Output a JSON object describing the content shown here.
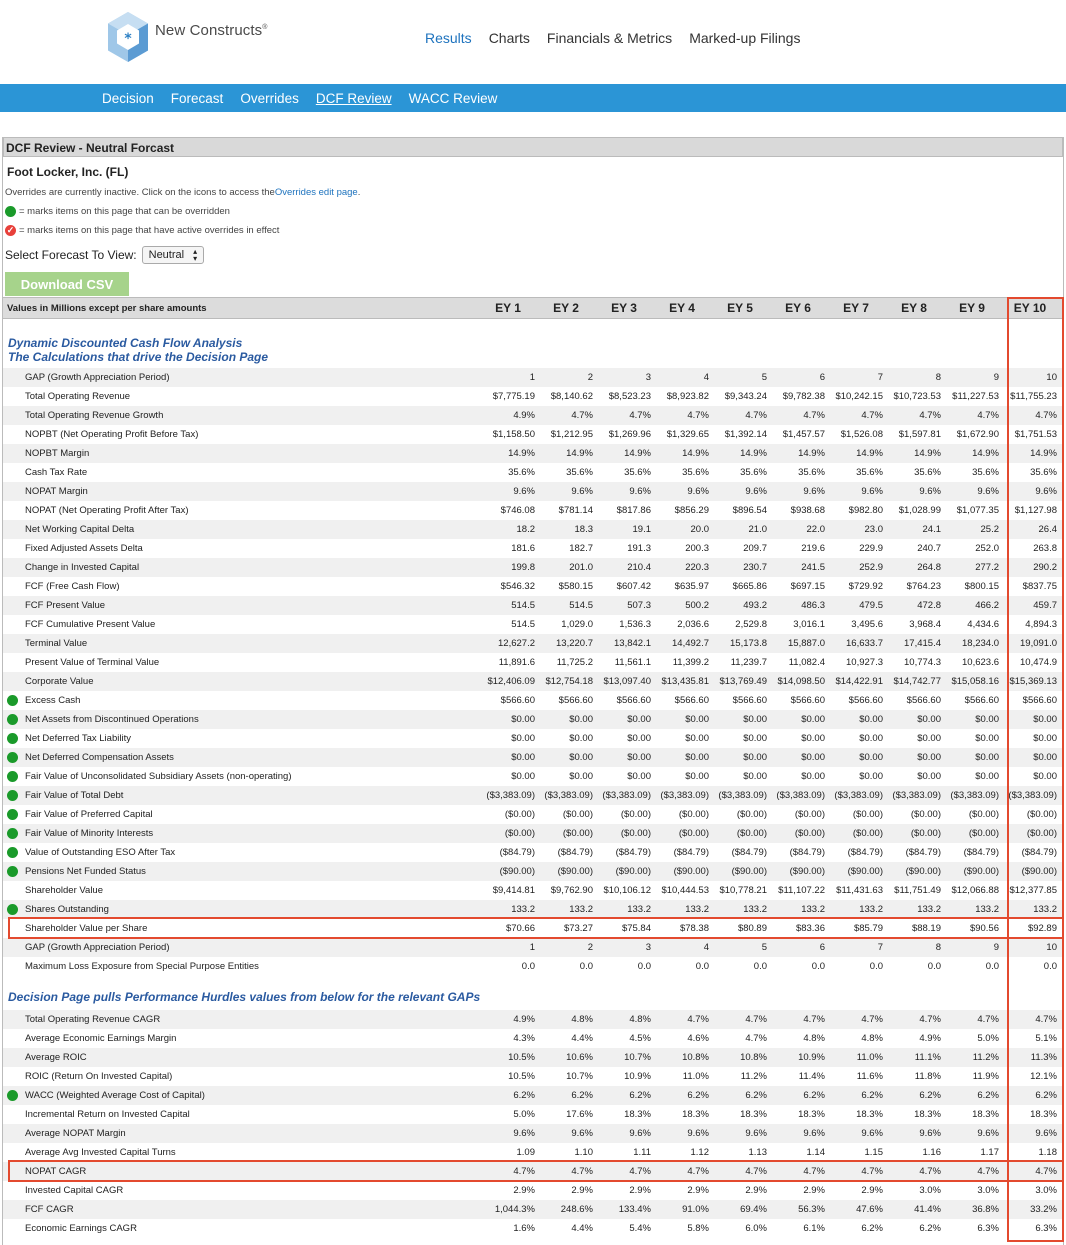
{
  "brand": {
    "name": "New Constructs",
    "mark": "®"
  },
  "top_nav": [
    {
      "label": "Results",
      "active": true
    },
    {
      "label": "Charts",
      "active": false
    },
    {
      "label": "Financials & Metrics",
      "active": false
    },
    {
      "label": "Marked-up Filings",
      "active": false
    }
  ],
  "sub_nav": [
    {
      "label": "Decision",
      "active": false
    },
    {
      "label": "Forecast",
      "active": false
    },
    {
      "label": "Overrides",
      "active": false
    },
    {
      "label": "DCF Review",
      "active": true
    },
    {
      "label": "WACC Review",
      "active": false
    }
  ],
  "panel": {
    "title": "DCF Review - Neutral Forcast",
    "company": "Foot Locker, Inc. (FL)",
    "override_note": "Overrides are currently inactive. Click on the icons to access the ",
    "override_link": "Overrides edit page",
    "override_note_end": ".",
    "legend_green": "= marks items on this page that can be overridden",
    "legend_red": "= marks items on this page that have active overrides in effect",
    "select_label": "Select Forecast To View:",
    "select_value": "Neutral",
    "csv_button": "Download CSV"
  },
  "table": {
    "header_label": "Values in Millions except per share amounts",
    "columns": [
      "EY 1",
      "EY 2",
      "EY 3",
      "EY 4",
      "EY 5",
      "EY 6",
      "EY 7",
      "EY 8",
      "EY 9",
      "EY 10"
    ],
    "section1_title": "Dynamic Discounted Cash Flow Analysis",
    "section1_subtitle": "The Calculations that drive the Decision Page",
    "section1_rows": [
      {
        "label": "GAP (Growth Appreciation Period)",
        "dot": false,
        "values": [
          "1",
          "2",
          "3",
          "4",
          "5",
          "6",
          "7",
          "8",
          "9",
          "10"
        ]
      },
      {
        "label": "Total Operating Revenue",
        "dot": false,
        "values": [
          "$7,775.19",
          "$8,140.62",
          "$8,523.23",
          "$8,923.82",
          "$9,343.24",
          "$9,782.38",
          "$10,242.15",
          "$10,723.53",
          "$11,227.53",
          "$11,755.23"
        ]
      },
      {
        "label": "Total Operating Revenue Growth",
        "dot": false,
        "values": [
          "4.9%",
          "4.7%",
          "4.7%",
          "4.7%",
          "4.7%",
          "4.7%",
          "4.7%",
          "4.7%",
          "4.7%",
          "4.7%"
        ]
      },
      {
        "label": "NOPBT (Net Operating Profit Before Tax)",
        "dot": false,
        "values": [
          "$1,158.50",
          "$1,212.95",
          "$1,269.96",
          "$1,329.65",
          "$1,392.14",
          "$1,457.57",
          "$1,526.08",
          "$1,597.81",
          "$1,672.90",
          "$1,751.53"
        ]
      },
      {
        "label": "NOPBT Margin",
        "dot": false,
        "values": [
          "14.9%",
          "14.9%",
          "14.9%",
          "14.9%",
          "14.9%",
          "14.9%",
          "14.9%",
          "14.9%",
          "14.9%",
          "14.9%"
        ]
      },
      {
        "label": "Cash Tax Rate",
        "dot": false,
        "values": [
          "35.6%",
          "35.6%",
          "35.6%",
          "35.6%",
          "35.6%",
          "35.6%",
          "35.6%",
          "35.6%",
          "35.6%",
          "35.6%"
        ]
      },
      {
        "label": "NOPAT Margin",
        "dot": false,
        "values": [
          "9.6%",
          "9.6%",
          "9.6%",
          "9.6%",
          "9.6%",
          "9.6%",
          "9.6%",
          "9.6%",
          "9.6%",
          "9.6%"
        ]
      },
      {
        "label": "NOPAT (Net Operating Profit After Tax)",
        "dot": false,
        "values": [
          "$746.08",
          "$781.14",
          "$817.86",
          "$856.29",
          "$896.54",
          "$938.68",
          "$982.80",
          "$1,028.99",
          "$1,077.35",
          "$1,127.98"
        ]
      },
      {
        "label": "Net Working Capital Delta",
        "dot": false,
        "values": [
          "18.2",
          "18.3",
          "19.1",
          "20.0",
          "21.0",
          "22.0",
          "23.0",
          "24.1",
          "25.2",
          "26.4"
        ]
      },
      {
        "label": "Fixed Adjusted Assets Delta",
        "dot": false,
        "values": [
          "181.6",
          "182.7",
          "191.3",
          "200.3",
          "209.7",
          "219.6",
          "229.9",
          "240.7",
          "252.0",
          "263.8"
        ]
      },
      {
        "label": "Change in Invested Capital",
        "dot": false,
        "values": [
          "199.8",
          "201.0",
          "210.4",
          "220.3",
          "230.7",
          "241.5",
          "252.9",
          "264.8",
          "277.2",
          "290.2"
        ]
      },
      {
        "label": "FCF (Free Cash Flow)",
        "dot": false,
        "values": [
          "$546.32",
          "$580.15",
          "$607.42",
          "$635.97",
          "$665.86",
          "$697.15",
          "$729.92",
          "$764.23",
          "$800.15",
          "$837.75"
        ]
      },
      {
        "label": "FCF Present Value",
        "dot": false,
        "values": [
          "514.5",
          "514.5",
          "507.3",
          "500.2",
          "493.2",
          "486.3",
          "479.5",
          "472.8",
          "466.2",
          "459.7"
        ]
      },
      {
        "label": "FCF Cumulative Present Value",
        "dot": false,
        "values": [
          "514.5",
          "1,029.0",
          "1,536.3",
          "2,036.6",
          "2,529.8",
          "3,016.1",
          "3,495.6",
          "3,968.4",
          "4,434.6",
          "4,894.3"
        ]
      },
      {
        "label": "Terminal Value",
        "dot": false,
        "values": [
          "12,627.2",
          "13,220.7",
          "13,842.1",
          "14,492.7",
          "15,173.8",
          "15,887.0",
          "16,633.7",
          "17,415.4",
          "18,234.0",
          "19,091.0"
        ]
      },
      {
        "label": "Present Value of Terminal Value",
        "dot": false,
        "values": [
          "11,891.6",
          "11,725.2",
          "11,561.1",
          "11,399.2",
          "11,239.7",
          "11,082.4",
          "10,927.3",
          "10,774.3",
          "10,623.6",
          "10,474.9"
        ]
      },
      {
        "label": "Corporate Value",
        "dot": false,
        "values": [
          "$12,406.09",
          "$12,754.18",
          "$13,097.40",
          "$13,435.81",
          "$13,769.49",
          "$14,098.50",
          "$14,422.91",
          "$14,742.77",
          "$15,058.16",
          "$15,369.13"
        ]
      },
      {
        "label": "Excess Cash",
        "dot": true,
        "values": [
          "$566.60",
          "$566.60",
          "$566.60",
          "$566.60",
          "$566.60",
          "$566.60",
          "$566.60",
          "$566.60",
          "$566.60",
          "$566.60"
        ]
      },
      {
        "label": "Net Assets from Discontinued Operations",
        "dot": true,
        "values": [
          "$0.00",
          "$0.00",
          "$0.00",
          "$0.00",
          "$0.00",
          "$0.00",
          "$0.00",
          "$0.00",
          "$0.00",
          "$0.00"
        ]
      },
      {
        "label": "Net Deferred Tax Liability",
        "dot": true,
        "values": [
          "$0.00",
          "$0.00",
          "$0.00",
          "$0.00",
          "$0.00",
          "$0.00",
          "$0.00",
          "$0.00",
          "$0.00",
          "$0.00"
        ]
      },
      {
        "label": "Net Deferred Compensation Assets",
        "dot": true,
        "values": [
          "$0.00",
          "$0.00",
          "$0.00",
          "$0.00",
          "$0.00",
          "$0.00",
          "$0.00",
          "$0.00",
          "$0.00",
          "$0.00"
        ]
      },
      {
        "label": "Fair Value of Unconsolidated Subsidiary Assets (non-operating)",
        "dot": true,
        "values": [
          "$0.00",
          "$0.00",
          "$0.00",
          "$0.00",
          "$0.00",
          "$0.00",
          "$0.00",
          "$0.00",
          "$0.00",
          "$0.00"
        ]
      },
      {
        "label": "Fair Value of Total Debt",
        "dot": true,
        "values": [
          "($3,383.09)",
          "($3,383.09)",
          "($3,383.09)",
          "($3,383.09)",
          "($3,383.09)",
          "($3,383.09)",
          "($3,383.09)",
          "($3,383.09)",
          "($3,383.09)",
          "($3,383.09)"
        ]
      },
      {
        "label": "Fair Value of Preferred Capital",
        "dot": true,
        "values": [
          "($0.00)",
          "($0.00)",
          "($0.00)",
          "($0.00)",
          "($0.00)",
          "($0.00)",
          "($0.00)",
          "($0.00)",
          "($0.00)",
          "($0.00)"
        ]
      },
      {
        "label": "Fair Value of Minority Interests",
        "dot": true,
        "values": [
          "($0.00)",
          "($0.00)",
          "($0.00)",
          "($0.00)",
          "($0.00)",
          "($0.00)",
          "($0.00)",
          "($0.00)",
          "($0.00)",
          "($0.00)"
        ]
      },
      {
        "label": "Value of Outstanding ESO After Tax",
        "dot": true,
        "values": [
          "($84.79)",
          "($84.79)",
          "($84.79)",
          "($84.79)",
          "($84.79)",
          "($84.79)",
          "($84.79)",
          "($84.79)",
          "($84.79)",
          "($84.79)"
        ]
      },
      {
        "label": "Pensions Net Funded Status",
        "dot": true,
        "values": [
          "($90.00)",
          "($90.00)",
          "($90.00)",
          "($90.00)",
          "($90.00)",
          "($90.00)",
          "($90.00)",
          "($90.00)",
          "($90.00)",
          "($90.00)"
        ]
      },
      {
        "label": "Shareholder Value",
        "dot": false,
        "values": [
          "$9,414.81",
          "$9,762.90",
          "$10,106.12",
          "$10,444.53",
          "$10,778.21",
          "$11,107.22",
          "$11,431.63",
          "$11,751.49",
          "$12,066.88",
          "$12,377.85"
        ]
      },
      {
        "label": "Shares Outstanding",
        "dot": true,
        "values": [
          "133.2",
          "133.2",
          "133.2",
          "133.2",
          "133.2",
          "133.2",
          "133.2",
          "133.2",
          "133.2",
          "133.2"
        ]
      },
      {
        "label": "Shareholder Value per Share",
        "dot": false,
        "values": [
          "$70.66",
          "$73.27",
          "$75.84",
          "$78.38",
          "$80.89",
          "$83.36",
          "$85.79",
          "$88.19",
          "$90.56",
          "$92.89"
        ]
      },
      {
        "label": "GAP (Growth Appreciation Period)",
        "dot": false,
        "values": [
          "1",
          "2",
          "3",
          "4",
          "5",
          "6",
          "7",
          "8",
          "9",
          "10"
        ]
      },
      {
        "label": "Maximum Loss Exposure from Special Purpose Entities",
        "dot": false,
        "values": [
          "0.0",
          "0.0",
          "0.0",
          "0.0",
          "0.0",
          "0.0",
          "0.0",
          "0.0",
          "0.0",
          "0.0"
        ]
      }
    ],
    "section2_title": "Decision Page pulls Performance Hurdles values from below for the relevant GAPs",
    "section2_rows": [
      {
        "label": "Total Operating Revenue CAGR",
        "dot": false,
        "values": [
          "4.9%",
          "4.8%",
          "4.8%",
          "4.7%",
          "4.7%",
          "4.7%",
          "4.7%",
          "4.7%",
          "4.7%",
          "4.7%"
        ]
      },
      {
        "label": "Average Economic Earnings Margin",
        "dot": false,
        "values": [
          "4.3%",
          "4.4%",
          "4.5%",
          "4.6%",
          "4.7%",
          "4.8%",
          "4.8%",
          "4.9%",
          "5.0%",
          "5.1%"
        ]
      },
      {
        "label": "Average ROIC",
        "dot": false,
        "values": [
          "10.5%",
          "10.6%",
          "10.7%",
          "10.8%",
          "10.8%",
          "10.9%",
          "11.0%",
          "11.1%",
          "11.2%",
          "11.3%"
        ]
      },
      {
        "label": "ROIC (Return On Invested Capital)",
        "dot": false,
        "values": [
          "10.5%",
          "10.7%",
          "10.9%",
          "11.0%",
          "11.2%",
          "11.4%",
          "11.6%",
          "11.8%",
          "11.9%",
          "12.1%"
        ]
      },
      {
        "label": "WACC (Weighted Average Cost of Capital)",
        "dot": true,
        "values": [
          "6.2%",
          "6.2%",
          "6.2%",
          "6.2%",
          "6.2%",
          "6.2%",
          "6.2%",
          "6.2%",
          "6.2%",
          "6.2%"
        ]
      },
      {
        "label": "Incremental Return on Invested Capital",
        "dot": false,
        "values": [
          "5.0%",
          "17.6%",
          "18.3%",
          "18.3%",
          "18.3%",
          "18.3%",
          "18.3%",
          "18.3%",
          "18.3%",
          "18.3%"
        ]
      },
      {
        "label": "Average NOPAT Margin",
        "dot": false,
        "values": [
          "9.6%",
          "9.6%",
          "9.6%",
          "9.6%",
          "9.6%",
          "9.6%",
          "9.6%",
          "9.6%",
          "9.6%",
          "9.6%"
        ]
      },
      {
        "label": "Average Avg Invested Capital Turns",
        "dot": false,
        "values": [
          "1.09",
          "1.10",
          "1.11",
          "1.12",
          "1.13",
          "1.14",
          "1.15",
          "1.16",
          "1.17",
          "1.18"
        ]
      },
      {
        "label": "NOPAT CAGR",
        "dot": false,
        "values": [
          "4.7%",
          "4.7%",
          "4.7%",
          "4.7%",
          "4.7%",
          "4.7%",
          "4.7%",
          "4.7%",
          "4.7%",
          "4.7%"
        ]
      },
      {
        "label": "Invested Capital CAGR",
        "dot": false,
        "values": [
          "2.9%",
          "2.9%",
          "2.9%",
          "2.9%",
          "2.9%",
          "2.9%",
          "2.9%",
          "3.0%",
          "3.0%",
          "3.0%"
        ]
      },
      {
        "label": "FCF CAGR",
        "dot": false,
        "values": [
          "1,044.3%",
          "248.6%",
          "133.4%",
          "91.0%",
          "69.4%",
          "56.3%",
          "47.6%",
          "41.4%",
          "36.8%",
          "33.2%"
        ]
      },
      {
        "label": "Economic Earnings CAGR",
        "dot": false,
        "values": [
          "1.6%",
          "4.4%",
          "5.4%",
          "5.8%",
          "6.0%",
          "6.1%",
          "6.2%",
          "6.2%",
          "6.3%",
          "6.3%"
        ]
      }
    ]
  }
}
